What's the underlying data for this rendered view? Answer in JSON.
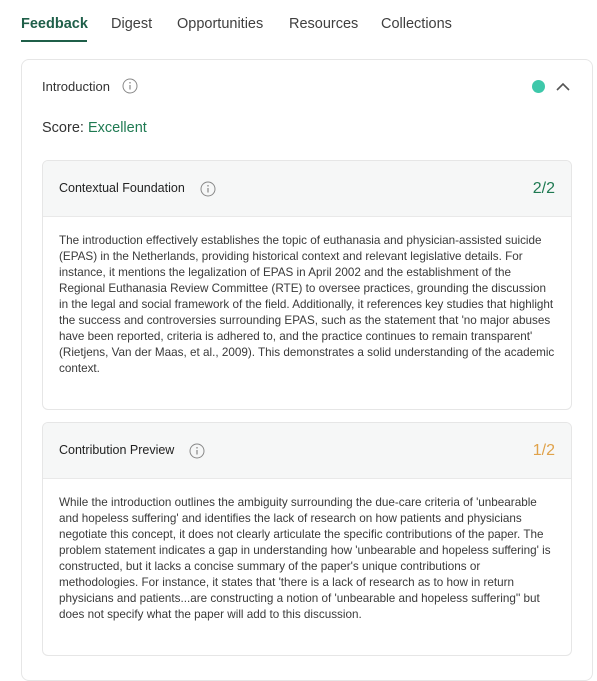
{
  "tabs": [
    {
      "label": "Feedback",
      "active": true
    },
    {
      "label": "Digest",
      "active": false
    },
    {
      "label": "Opportunities",
      "active": false
    },
    {
      "label": "Resources",
      "active": false
    },
    {
      "label": "Collections",
      "active": false
    }
  ],
  "section": {
    "title": "Introduction",
    "status_color": "#3ec8aa",
    "score_label": "Score:",
    "score_value": "Excellent"
  },
  "cards": [
    {
      "title": "Contextual Foundation",
      "score": "2/2",
      "score_color": "#1f7a52",
      "body": "The introduction effectively establishes the topic of euthanasia and physician-assisted suicide (EPAS) in the Netherlands, providing historical context and relevant legislative details. For instance, it mentions the legalization of EPAS in April 2002 and the establishment of the Regional Euthanasia Review Committee (RTE) to oversee practices, grounding the discussion in the legal and social framework of the field. Additionally, it references key studies that highlight the success and controversies surrounding EPAS, such as the statement that 'no major abuses have been reported, criteria is adhered to, and the practice continues to remain transparent' (Rietjens, Van der Maas, et al., 2009). This demonstrates a solid understanding of the academic context."
    },
    {
      "title": "Contribution Preview",
      "score": "1/2",
      "score_color": "#e0a24a",
      "body": "While the introduction outlines the ambiguity surrounding the due-care criteria of 'unbearable and hopeless suffering' and identifies the lack of research on how patients and physicians negotiate this concept, it does not clearly articulate the specific contributions of the paper. The problem statement indicates a gap in understanding how 'unbearable and hopeless suffering' is constructed, but it lacks a concise summary of the paper's unique contributions or methodologies. For instance, it states that 'there is a lack of research as to how in return physicians and patients...are constructing a notion of 'unbearable and hopeless suffering'' but does not specify what the paper will add to this discussion."
    }
  ]
}
